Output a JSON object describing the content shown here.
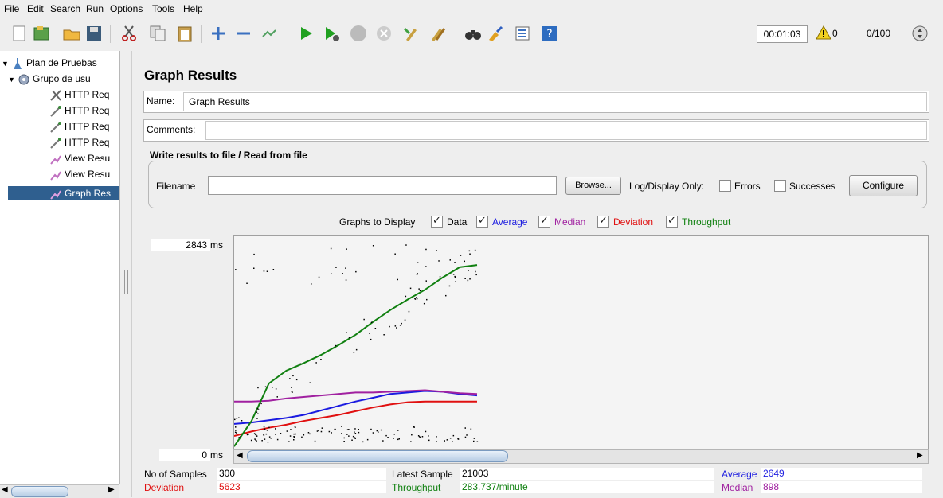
{
  "menu": [
    "File",
    "Edit",
    "Search",
    "Run",
    "Options",
    "Tools",
    "Help"
  ],
  "toolbar": {
    "timer": "00:01:03",
    "warnings": "0",
    "threads": "0/100"
  },
  "tree": {
    "items": [
      {
        "label": "Plan de Pruebas",
        "icon": "test-plan-icon"
      },
      {
        "label": "Grupo de usu",
        "icon": "thread-group-icon"
      },
      {
        "label": "HTTP Req",
        "icon": "http-sampler-icon"
      },
      {
        "label": "HTTP Req",
        "icon": "http-sampler-icon"
      },
      {
        "label": "HTTP Req",
        "icon": "http-sampler-icon"
      },
      {
        "label": "HTTP Req",
        "icon": "http-sampler-icon"
      },
      {
        "label": "View Resu",
        "icon": "listener-icon"
      },
      {
        "label": "View Resu",
        "icon": "listener-icon"
      },
      {
        "label": "Graph Res",
        "icon": "graph-listener-icon",
        "selected": true
      }
    ]
  },
  "panel": {
    "title": "Graph Results",
    "name_label": "Name:",
    "name_value": "Graph Results",
    "comments_label": "Comments:",
    "comments_value": "",
    "file_group_title": "Write results to file / Read from file",
    "filename_label": "Filename",
    "filename_value": "",
    "browse_label": "Browse...",
    "log_display_label": "Log/Display Only:",
    "errors_label": "Errors",
    "successes_label": "Successes",
    "configure_label": "Configure"
  },
  "graphs_to_display": {
    "label": "Graphs to Display",
    "options": [
      {
        "label": "Data",
        "color": "#000000",
        "checked": true
      },
      {
        "label": "Average",
        "color": "#2020e0",
        "checked": true
      },
      {
        "label": "Median",
        "color": "#a020a0",
        "checked": true
      },
      {
        "label": "Deviation",
        "color": "#e01010",
        "checked": true
      },
      {
        "label": "Throughput",
        "color": "#108010",
        "checked": true
      }
    ]
  },
  "graph": {
    "ymax_label": "2843",
    "ymin_label": "0",
    "unit": "ms"
  },
  "chart_data": {
    "type": "line",
    "ylim": [
      0,
      2843
    ],
    "series": [
      {
        "name": "Average",
        "color": "#1a1ae0",
        "values": [
          340,
          360,
          390,
          420,
          460,
          520,
          580,
          640,
          690,
          740,
          760,
          780,
          770,
          740,
          720
        ]
      },
      {
        "name": "Median",
        "color": "#a020a0",
        "values": [
          640,
          640,
          650,
          680,
          700,
          720,
          740,
          760,
          760,
          770,
          780,
          790,
          770,
          750,
          740
        ]
      },
      {
        "name": "Deviation",
        "color": "#e01010",
        "values": [
          180,
          240,
          290,
          330,
          380,
          420,
          460,
          510,
          560,
          600,
          630,
          640,
          640,
          640,
          640
        ]
      },
      {
        "name": "Throughput",
        "color": "#108010",
        "values": [
          40,
          380,
          880,
          1050,
          1150,
          1260,
          1390,
          1530,
          1700,
          1860,
          2000,
          2130,
          2290,
          2430,
          2460
        ]
      }
    ]
  },
  "stats": {
    "samples_label": "No of Samples",
    "samples_value": "300",
    "latest_label": "Latest Sample",
    "latest_value": "21003",
    "average_label": "Average",
    "average_value": "2649",
    "deviation_label": "Deviation",
    "deviation_value": "5623",
    "throughput_label": "Throughput",
    "throughput_value": "283.737/minute",
    "median_label": "Median",
    "median_value": "898"
  },
  "colors": {
    "average": "#1a1ae0",
    "median": "#a020a0",
    "deviation": "#e01010",
    "throughput": "#108010",
    "selection": "#2f5f8f"
  }
}
